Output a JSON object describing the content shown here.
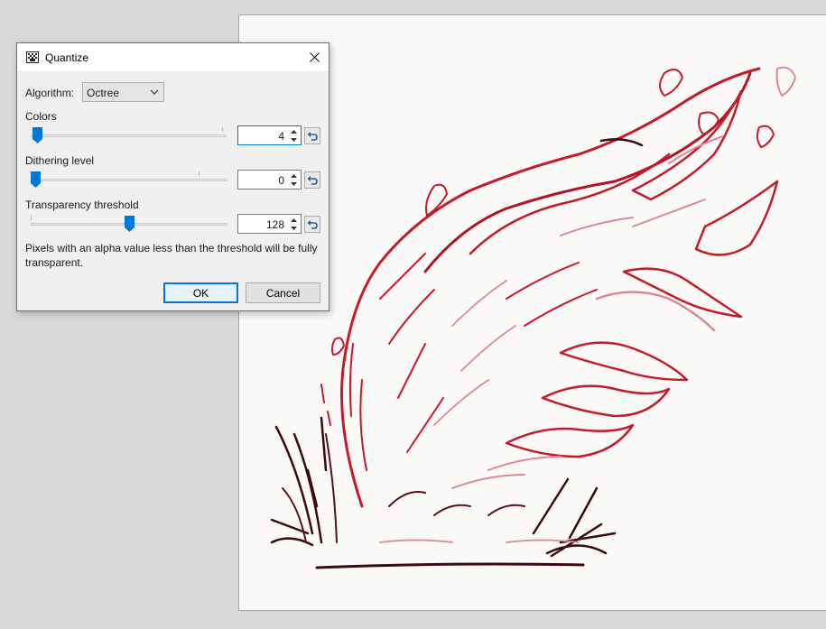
{
  "dialog": {
    "title": "Quantize",
    "algorithm_label": "Algorithm:",
    "algorithm_value": "Octree",
    "colors_label": "Colors",
    "colors_value": "4",
    "dithering_label": "Dithering level",
    "dithering_value": "0",
    "transparency_label": "Transparency threshold",
    "transparency_value": "128",
    "description": "Pixels with an alpha value less than the threshold will be fully transparent.",
    "ok_label": "OK",
    "cancel_label": "Cancel"
  },
  "accent_color": "#0078d7",
  "canvas_bg": "#fcf9f9",
  "ink_colors": [
    "#c41b2a",
    "#3a0a10",
    "#d98a98"
  ]
}
